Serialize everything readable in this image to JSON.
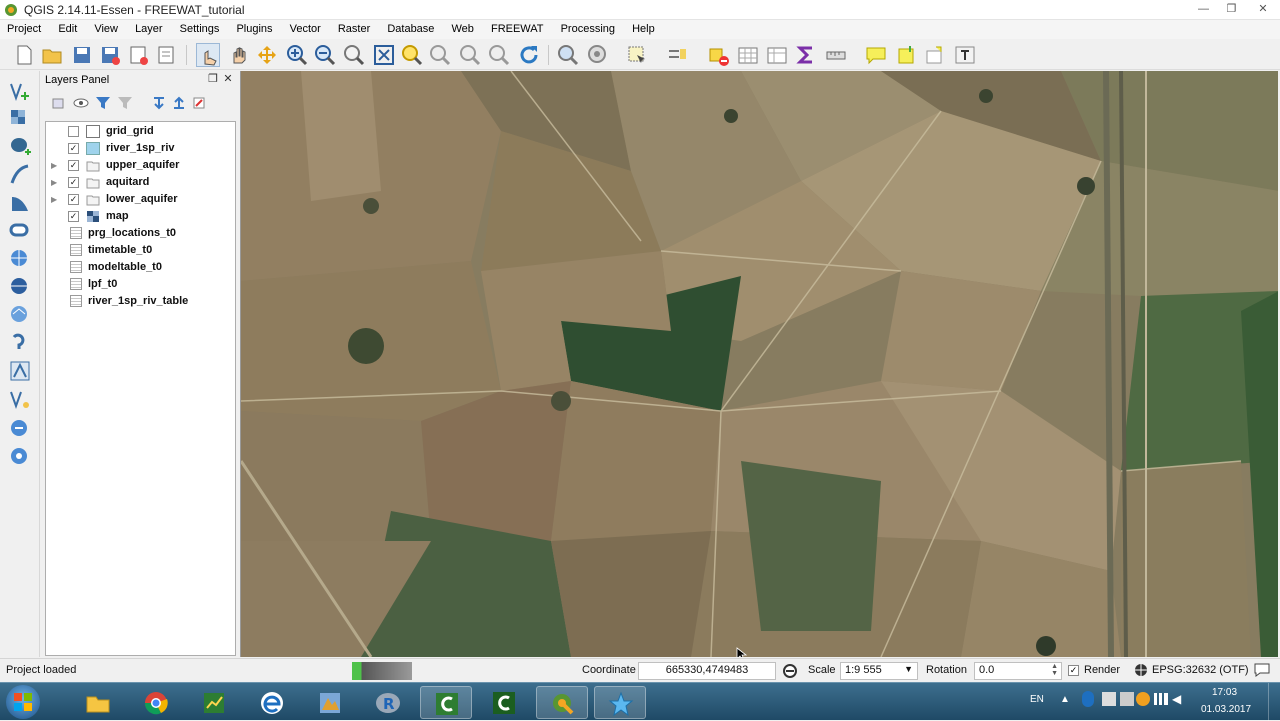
{
  "window": {
    "title": "QGIS 2.14.11-Essen - FREEWAT_tutorial",
    "minimize_label": "—",
    "maximize_label": "❐",
    "close_label": "✕"
  },
  "menu": [
    "Project",
    "Edit",
    "View",
    "Layer",
    "Settings",
    "Plugins",
    "Vector",
    "Raster",
    "Database",
    "Web",
    "FREEWAT",
    "Processing",
    "Help"
  ],
  "layers_panel": {
    "title": "Layers Panel",
    "layers": [
      {
        "name": "grid_grid",
        "checked": false,
        "expandable": false,
        "symbol": "grid"
      },
      {
        "name": "river_1sp_riv",
        "checked": true,
        "expandable": false,
        "symbol": "river"
      },
      {
        "name": "upper_aquifer",
        "checked": true,
        "expandable": true,
        "symbol": "group"
      },
      {
        "name": "aquitard",
        "checked": true,
        "expandable": true,
        "symbol": "group"
      },
      {
        "name": "lower_aquifer",
        "checked": true,
        "expandable": true,
        "symbol": "group"
      },
      {
        "name": "map",
        "checked": true,
        "expandable": false,
        "symbol": "raster"
      }
    ],
    "tables": [
      "prg_locations_t0",
      "timetable_t0",
      "modeltable_t0",
      "lpf_t0",
      "river_1sp_riv_table"
    ],
    "checkmark": "✓"
  },
  "status": {
    "message": "Project loaded",
    "coordinate_label": "Coordinate",
    "coordinate_value": "665330,4749483",
    "scale_label": "Scale",
    "scale_value": "1:9 555",
    "rotation_label": "Rotation",
    "rotation_value": "0.0",
    "render_label": "Render",
    "render_checked": true,
    "crs": "EPSG:32632 (OTF)"
  },
  "taskbar": {
    "language": "EN",
    "time": "17:03",
    "date": "01.03.2017"
  },
  "colors": {
    "taskbar_top": "#3d6f8e",
    "field_green": "#2e5a34",
    "field_brown": "#8b7a5c",
    "accent_blue": "#1e6fc0"
  }
}
